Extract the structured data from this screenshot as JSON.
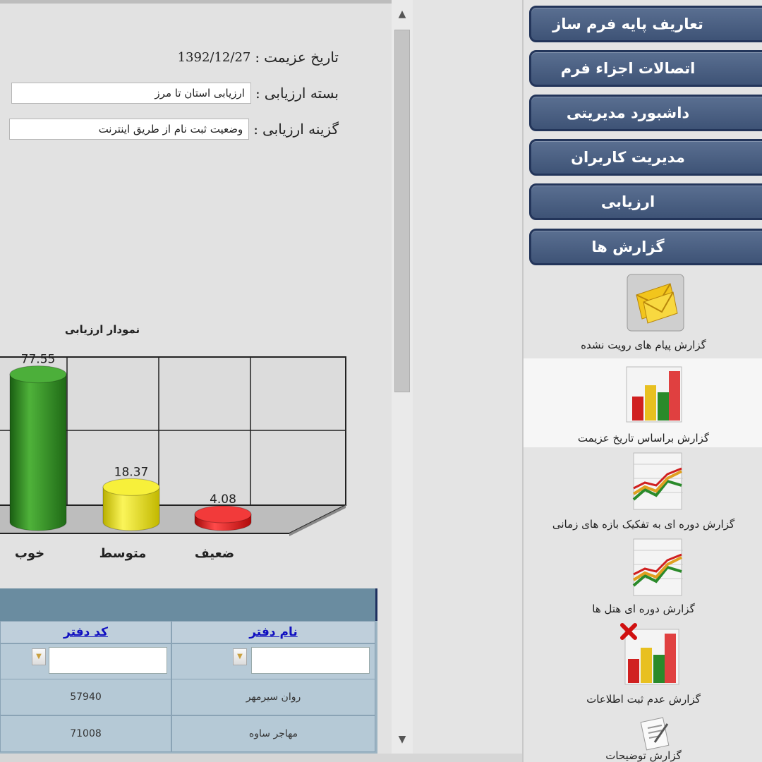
{
  "form": {
    "date_label": "تاریخ عزیمت",
    "date_value": "1392/12/27",
    "package_label": "بسته ارزیابی",
    "package_value": "ارزیابی استان تا مرز",
    "option_label": "گزینه ارزیابی",
    "option_value": "وضعیت ثبت نام از طریق اینترنت",
    "colon": ":"
  },
  "chart_data": {
    "type": "bar",
    "title": "نمودار ارزیابی",
    "categories": [
      "خوب",
      "متوسط",
      "ضعیف"
    ],
    "values": [
      77.55,
      18.37,
      4.08
    ],
    "colors": [
      "#2e8b22",
      "#e8e020",
      "#e02020"
    ],
    "ylim": [
      0,
      100
    ],
    "grid": true
  },
  "grid": {
    "columns": [
      "نام دفتر",
      "کد دفتر"
    ],
    "rows": [
      {
        "name": "روان سیرمهر",
        "code": "57940"
      },
      {
        "name": "مهاجر ساوه",
        "code": "71008"
      }
    ]
  },
  "menu": {
    "buttons": [
      "تعاریف پایه فرم ساز",
      "اتصالات اجزاء فرم",
      "داشبورد مدیریتی",
      "مدیریت کاربران",
      "ارزیابی",
      "گزارش ها"
    ],
    "reports": [
      {
        "label": "گزارش پیام های رویت نشده",
        "icon": "envelope-icon"
      },
      {
        "label": "گزارش براساس تاریخ عزیمت",
        "icon": "bar-chart-icon"
      },
      {
        "label": "گزارش دوره ای به تفکیک بازه های زمانی",
        "icon": "line-chart-icon"
      },
      {
        "label": "گزارش دوره ای هتل ها",
        "icon": "line-chart-icon"
      },
      {
        "label": "گزارش عدم ثبت اطلاعات",
        "icon": "bar-chart-error-icon"
      },
      {
        "label": "گزارش توضیحات",
        "icon": "notes-icon"
      }
    ]
  }
}
